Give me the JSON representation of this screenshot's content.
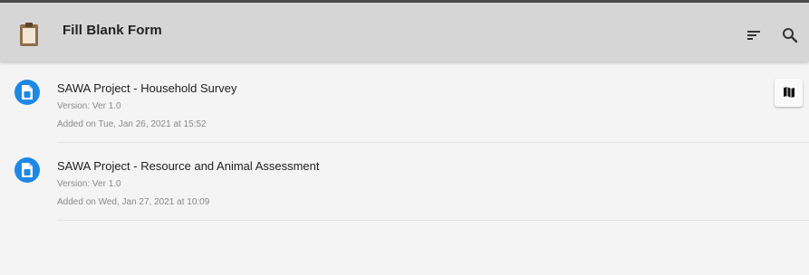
{
  "toolbar": {
    "title": "Fill Blank Form",
    "app_icon": "clipboard-icon",
    "actions": [
      "sort-icon",
      "search-icon"
    ]
  },
  "forms": [
    {
      "name": "SAWA Project - Household Survey",
      "version": "Version: Ver 1.0",
      "added": "Added on Tue, Jan 26, 2021 at 15:52",
      "icon": "form-icon",
      "has_map_button": true,
      "map_icon": "map-icon"
    },
    {
      "name": "SAWA Project - Resource and Animal Assessment",
      "version": "Version: Ver 1.0",
      "added": "Added on Wed, Jan 27, 2021 at 10:09",
      "icon": "form-icon",
      "has_map_button": false
    }
  ],
  "colors": {
    "toolbar_bg": "#d6d6d6",
    "page_bg": "#f4f4f4",
    "form_icon_bg": "#1e88e5",
    "clipboard_brown": "#8d6e4a"
  }
}
